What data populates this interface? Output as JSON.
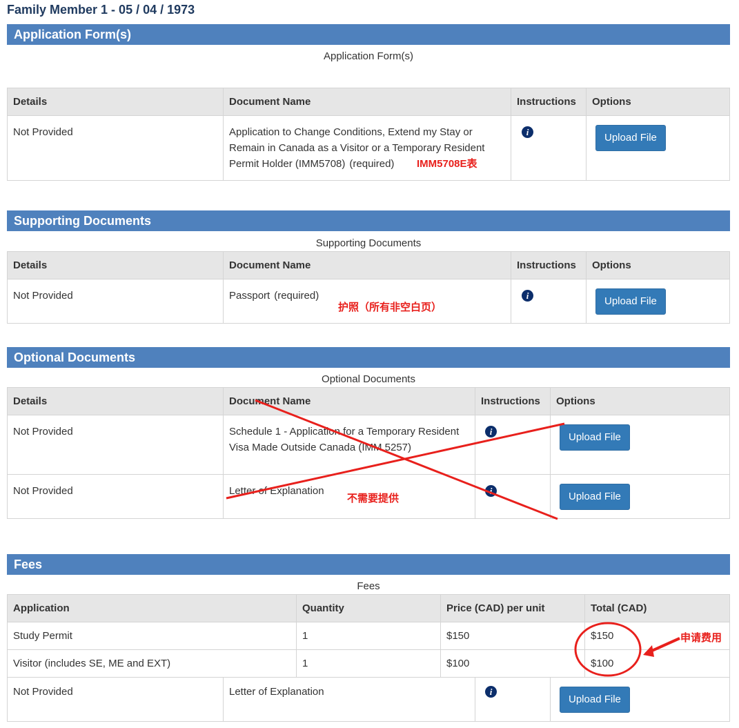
{
  "page_title": "Family Member 1 - 05 / 04 / 1973",
  "headers": {
    "details": "Details",
    "document_name": "Document Name",
    "instructions": "Instructions",
    "options": "Options"
  },
  "info_icon": "i",
  "application_forms": {
    "title": "Application Form(s)",
    "caption": "Application Form(s)",
    "rows": [
      {
        "details": "Not Provided",
        "document_name": "Application to Change Conditions, Extend my Stay or Remain in Canada as a Visitor or a Temporary Resident Permit Holder (IMM5708)",
        "required": "(required)",
        "button": "Upload File"
      }
    ]
  },
  "supporting_documents": {
    "title": "Supporting Documents",
    "caption": "Supporting Documents",
    "rows": [
      {
        "details": "Not Provided",
        "document_name": "Passport",
        "required": "(required)",
        "button": "Upload File"
      }
    ]
  },
  "optional_documents": {
    "title": "Optional Documents",
    "caption": "Optional Documents",
    "rows": [
      {
        "details": "Not Provided",
        "document_name": "Schedule 1 - Application for a Temporary Resident Visa Made Outside Canada (IMM 5257)",
        "button": "Upload File"
      },
      {
        "details": "Not Provided",
        "document_name": "Letter of Explanation",
        "button": "Upload File"
      }
    ]
  },
  "fees": {
    "title": "Fees",
    "caption": "Fees",
    "headers": {
      "application": "Application",
      "quantity": "Quantity",
      "price": "Price (CAD) per unit",
      "total": "Total (CAD)"
    },
    "rows": [
      {
        "application": "Study Permit",
        "quantity": "1",
        "price": "$150",
        "total": "$150"
      },
      {
        "application": "Visitor (includes SE, ME and EXT)",
        "quantity": "1",
        "price": "$100",
        "total": "$100"
      }
    ]
  },
  "bottom_row": {
    "details": "Not Provided",
    "document_name": "Letter of Explanation",
    "button": "Upload File"
  },
  "annotations": {
    "imm5708": "IMM5708E表",
    "passport": "护照（所有非空白页）",
    "not_needed": "不需要提供",
    "fees": "申请费用"
  },
  "colors": {
    "section_bar": "#4f81bd",
    "title_text": "#1f3a5f",
    "button": "#337ab7",
    "annotation": "#e8201c",
    "info_icon": "#0c2e6b"
  }
}
